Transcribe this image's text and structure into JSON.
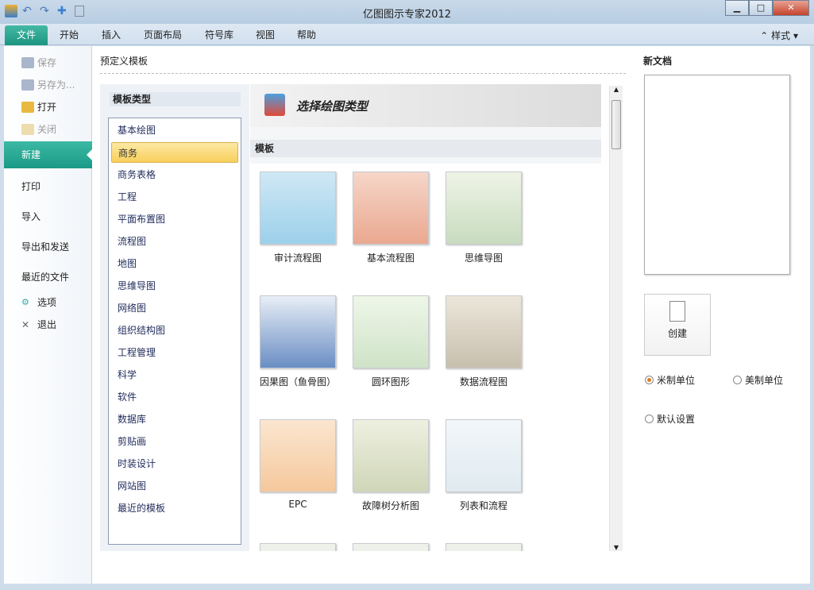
{
  "window": {
    "title": "亿图图示专家2012",
    "minimize": "▁",
    "maximize": "□",
    "close": "✕"
  },
  "ribbon": {
    "tabs": [
      "文件",
      "开始",
      "插入",
      "页面布局",
      "符号库",
      "视图",
      "帮助"
    ],
    "style_label": "样式"
  },
  "backstage": {
    "items": [
      {
        "label": "保存",
        "icon": "save-icon",
        "disabled": true
      },
      {
        "label": "另存为...",
        "icon": "save-as-icon",
        "disabled": true
      },
      {
        "label": "打开",
        "icon": "open-folder-icon",
        "disabled": false
      },
      {
        "label": "关闭",
        "icon": "close-folder-icon",
        "disabled": true
      },
      {
        "label": "新建",
        "selected": true
      },
      {
        "label": "打印"
      },
      {
        "label": "导入"
      },
      {
        "label": "导出和发送"
      },
      {
        "label": "最近的文件"
      },
      {
        "label": "选项",
        "icon": "options-icon"
      },
      {
        "label": "退出",
        "icon": "exit-icon"
      }
    ]
  },
  "main": {
    "section_title": "预定义模板",
    "category_header": "模板类型",
    "categories": [
      "基本绘图",
      "商务",
      "商务表格",
      "工程",
      "平面布置图",
      "流程图",
      "地图",
      "思维导图",
      "网络图",
      "组织结构图",
      "工程管理",
      "科学",
      "软件",
      "数据库",
      "剪贴画",
      "时装设计",
      "网站图",
      "最近的模板"
    ],
    "selected_category": "商务",
    "banner_title": "选择绘图类型",
    "templates_header": "模板",
    "templates": [
      "审计流程图",
      "基本流程图",
      "思维导图",
      "因果图（鱼骨图）",
      "圆环图形",
      "数据流程图",
      "EPC",
      "故障树分析图",
      "列表和流程"
    ]
  },
  "right": {
    "title": "新文档",
    "create_label": "创建",
    "units": [
      {
        "label": "米制单位",
        "checked": true
      },
      {
        "label": "美制单位",
        "checked": false
      }
    ],
    "default_settings": "默认设置"
  },
  "colors": {
    "accent": "#1f9c88",
    "selected": "#f8cf5b"
  }
}
